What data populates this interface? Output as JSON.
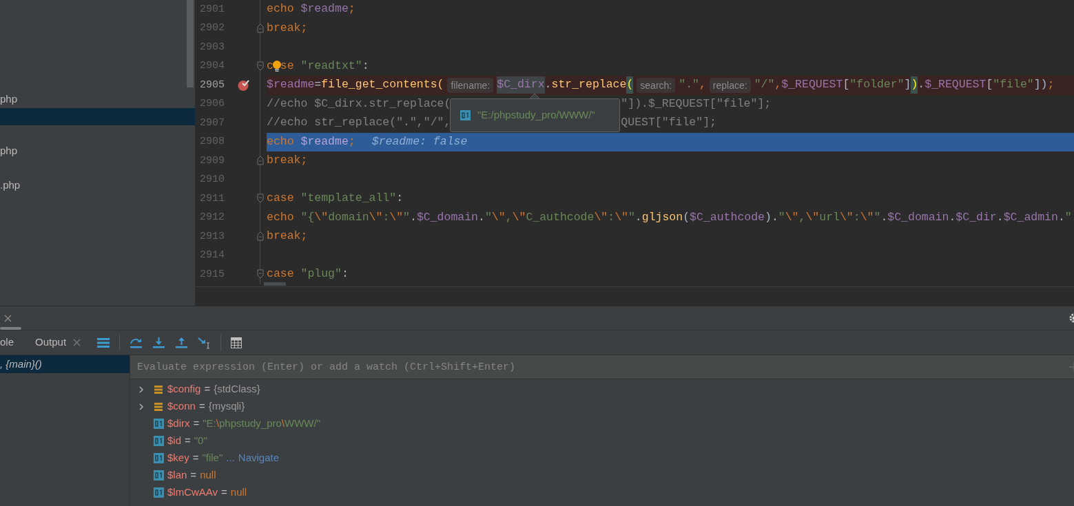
{
  "project_tree": {
    "items": [
      {
        "label": "php",
        "selected": false
      },
      {
        "selected": true
      },
      {
        "selected": false
      },
      {
        "label": "php",
        "selected": false
      },
      {
        "selected": false
      },
      {
        "label": ".php",
        "selected": false
      }
    ]
  },
  "editor": {
    "lines": [
      {
        "number": "2901",
        "tokens": [
          {
            "text": "echo ",
            "kind": "keyword"
          },
          {
            "text": "$readme",
            "kind": "var"
          },
          {
            "text": ";",
            "kind": "keyword"
          }
        ]
      },
      {
        "number": "2902",
        "fold_end": true,
        "tokens": [
          {
            "text": "break;",
            "kind": "keyword"
          }
        ]
      },
      {
        "number": "2903"
      },
      {
        "number": "2904",
        "fold_start": true,
        "tokens": [
          {
            "text": "c",
            "kind": "keyword"
          },
          {
            "kind": "bulb"
          },
          {
            "text": "se ",
            "kind": "keyword"
          },
          {
            "text": "\"readtxt\"",
            "kind": "string"
          },
          {
            "text": ":",
            "kind": "plain"
          }
        ]
      },
      {
        "number": "2905",
        "breakpoint": true,
        "tokens": [
          {
            "text": "$readme",
            "kind": "var"
          },
          {
            "text": "=",
            "kind": "plain"
          },
          {
            "text": "file_get_contents(",
            "kind": "func"
          },
          {
            "text": "filename:",
            "kind": "hint"
          },
          {
            "text": "$C_dirx",
            "kind": "var_focus"
          },
          {
            "text": ".",
            "kind": "plain"
          },
          {
            "text": "str_replace",
            "kind": "func"
          },
          {
            "text": "(",
            "kind": "brace"
          },
          {
            "text": "search:",
            "kind": "hint"
          },
          {
            "text": "\".\"",
            "kind": "string"
          },
          {
            "text": ",",
            "kind": "keyword"
          },
          {
            "text": "replace:",
            "kind": "hint"
          },
          {
            "text": "\"/\"",
            "kind": "string"
          },
          {
            "text": ",",
            "kind": "keyword"
          },
          {
            "text": "$_REQUEST",
            "kind": "var"
          },
          {
            "text": "[",
            "kind": "plain"
          },
          {
            "text": "\"folder\"",
            "kind": "string"
          },
          {
            "text": "]",
            "kind": "plain"
          },
          {
            "text": ")",
            "kind": "brace"
          },
          {
            "text": ".",
            "kind": "plain"
          },
          {
            "text": "$_REQUEST",
            "kind": "var"
          },
          {
            "text": "[",
            "kind": "plain"
          },
          {
            "text": "\"file\"",
            "kind": "string"
          },
          {
            "text": "])",
            "kind": "plain"
          },
          {
            "text": ";",
            "kind": "keyword"
          }
        ]
      },
      {
        "number": "2906",
        "tokens": [
          {
            "text": "//echo $C_dirx.str_replace(",
            "kind": "comment"
          },
          {
            "kind": "gap"
          },
          {
            "text": "\"]).$_REQUEST[\"file\"];",
            "kind": "comment"
          }
        ]
      },
      {
        "number": "2907",
        "tokens": [
          {
            "text": "//echo str_replace(\".\",\"/\",",
            "kind": "comment"
          },
          {
            "kind": "gap"
          },
          {
            "text": "QUEST[\"file\"];",
            "kind": "comment"
          }
        ]
      },
      {
        "number": "2908",
        "execution_point": true,
        "inline_value": "$readme: false",
        "tokens": [
          {
            "text": "echo ",
            "kind": "keyword"
          },
          {
            "text": "$readme",
            "kind": "var"
          },
          {
            "text": ";",
            "kind": "keyword"
          }
        ]
      },
      {
        "number": "2909",
        "fold_end": true,
        "tokens": [
          {
            "text": "break;",
            "kind": "keyword"
          }
        ]
      },
      {
        "number": "2910"
      },
      {
        "number": "2911",
        "fold_start": true,
        "tokens": [
          {
            "text": "case ",
            "kind": "keyword"
          },
          {
            "text": "\"template_all\"",
            "kind": "string"
          },
          {
            "text": ":",
            "kind": "plain"
          }
        ]
      },
      {
        "number": "2912",
        "tokens": [
          {
            "text": "echo ",
            "kind": "keyword"
          },
          {
            "text": "\"{",
            "kind": "string"
          },
          {
            "text": "\\\"",
            "kind": "escape"
          },
          {
            "text": "domain",
            "kind": "string"
          },
          {
            "text": "\\\"",
            "kind": "escape"
          },
          {
            "text": ":",
            "kind": "string"
          },
          {
            "text": "\\\"",
            "kind": "escape"
          },
          {
            "text": "\"",
            "kind": "string"
          },
          {
            "text": ".",
            "kind": "plain"
          },
          {
            "text": "$C_domain",
            "kind": "var"
          },
          {
            "text": ".",
            "kind": "plain"
          },
          {
            "text": "\"",
            "kind": "string"
          },
          {
            "text": "\\\"",
            "kind": "escape"
          },
          {
            "text": ",",
            "kind": "string"
          },
          {
            "text": "\\\"",
            "kind": "escape"
          },
          {
            "text": "C_authcode",
            "kind": "string"
          },
          {
            "text": "\\\"",
            "kind": "escape"
          },
          {
            "text": ":",
            "kind": "string"
          },
          {
            "text": "\\\"",
            "kind": "escape"
          },
          {
            "text": "\"",
            "kind": "string"
          },
          {
            "text": ".",
            "kind": "plain"
          },
          {
            "text": "gljson",
            "kind": "func"
          },
          {
            "text": "(",
            "kind": "plain"
          },
          {
            "text": "$C_authcode",
            "kind": "var"
          },
          {
            "text": ").",
            "kind": "plain"
          },
          {
            "text": "\"",
            "kind": "string"
          },
          {
            "text": "\\\"",
            "kind": "escape"
          },
          {
            "text": ",",
            "kind": "string"
          },
          {
            "text": "\\\"",
            "kind": "escape"
          },
          {
            "text": "url",
            "kind": "string"
          },
          {
            "text": "\\\"",
            "kind": "escape"
          },
          {
            "text": ":",
            "kind": "string"
          },
          {
            "text": "\\\"",
            "kind": "escape"
          },
          {
            "text": "\"",
            "kind": "string"
          },
          {
            "text": ".",
            "kind": "plain"
          },
          {
            "text": "$C_domain",
            "kind": "var"
          },
          {
            "text": ".",
            "kind": "plain"
          },
          {
            "text": "$C_dir",
            "kind": "var"
          },
          {
            "text": ".",
            "kind": "plain"
          },
          {
            "text": "$C_admin",
            "kind": "var"
          },
          {
            "text": ".",
            "kind": "plain"
          },
          {
            "text": "\"",
            "kind": "string"
          }
        ]
      },
      {
        "number": "2913",
        "fold_end": true,
        "tokens": [
          {
            "text": "break;",
            "kind": "keyword"
          }
        ]
      },
      {
        "number": "2914"
      },
      {
        "number": "2915",
        "fold_start": true,
        "tokens": [
          {
            "text": "case ",
            "kind": "keyword"
          },
          {
            "text": "\"plug\"",
            "kind": "string"
          },
          {
            "text": ":",
            "kind": "plain"
          }
        ]
      }
    ],
    "tooltip": {
      "value": "\"E:/phpstudy_pro/WWW/\""
    }
  },
  "debug_panel": {
    "tabs": [
      {
        "label": "ole",
        "selected": false
      },
      {
        "label": "Output",
        "selected": false,
        "closable": true
      }
    ],
    "frames": [
      {
        "label": ", {main}()",
        "selected": true
      }
    ],
    "watch_field": {
      "placeholder": "Evaluate expression (Enter) or add a watch (Ctrl+Shift+Enter)"
    },
    "variables": [
      {
        "kind": "object",
        "expanded": false,
        "name": "$config",
        "operator": "=",
        "value": [
          {
            "text": "{stdClass}",
            "kind": "class"
          }
        ]
      },
      {
        "kind": "object",
        "expanded": false,
        "name": "$conn",
        "operator": "=",
        "value": [
          {
            "text": "{mysqli}",
            "kind": "class"
          }
        ]
      },
      {
        "kind": "scalar",
        "name": "$dirx",
        "operator": "=",
        "value": [
          {
            "text": "\"E:",
            "kind": "string"
          },
          {
            "text": "\\",
            "kind": "escape"
          },
          {
            "text": "phpstudy_pro",
            "kind": "string"
          },
          {
            "text": "\\",
            "kind": "escape"
          },
          {
            "text": "WWW/\"",
            "kind": "string"
          }
        ]
      },
      {
        "kind": "scalar",
        "name": "$id",
        "operator": "=",
        "value": [
          {
            "text": "\"0\"",
            "kind": "string"
          }
        ]
      },
      {
        "kind": "scalar",
        "name": "$key",
        "operator": "=",
        "value": [
          {
            "text": "\"file\"",
            "kind": "string"
          },
          {
            "text": "...",
            "kind": "more"
          },
          {
            "text": "Navigate",
            "kind": "link"
          }
        ]
      },
      {
        "kind": "scalar",
        "name": "$lan",
        "operator": "=",
        "value": [
          {
            "text": "null",
            "kind": "null"
          }
        ]
      },
      {
        "kind": "scalar",
        "name": "$lmCwAAv",
        "operator": "=",
        "value": [
          {
            "text": "null",
            "kind": "null"
          }
        ]
      }
    ]
  }
}
